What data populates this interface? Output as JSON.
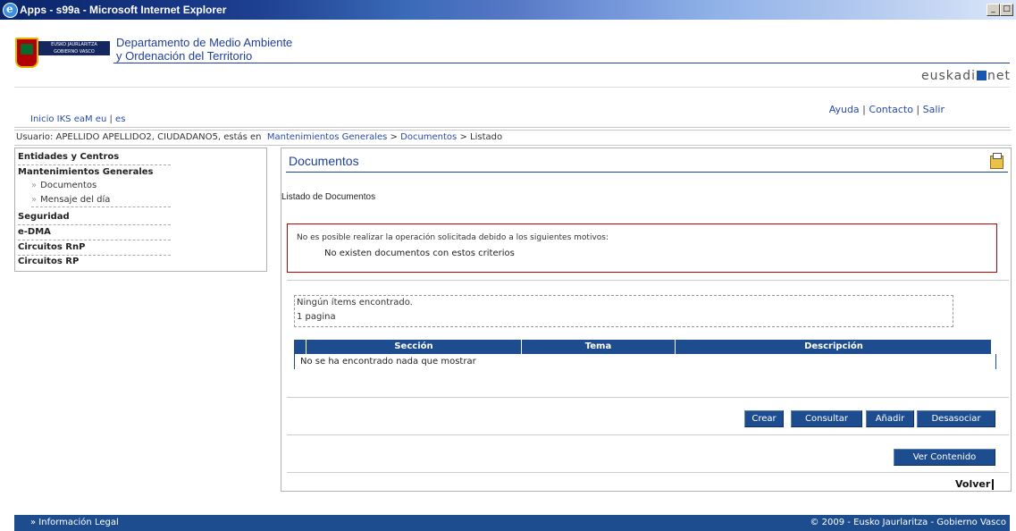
{
  "window": {
    "title": "Apps - s99a - Microsoft Internet Explorer"
  },
  "header": {
    "logo_text": "EUSKO JAURLARITZA GOBIERNO VASCO",
    "dept_line1": "Departamento de Medio Ambiente",
    "dept_line2": "y Ordenación del Territorio",
    "portal_pre": "euskadi",
    "portal_post": "net"
  },
  "topnav": {
    "links": [
      "Inicio",
      "IKS eaM",
      "eu",
      "es"
    ],
    "util": [
      "Ayuda",
      "Contacto",
      "Salir"
    ]
  },
  "userbar": {
    "prefix": "Usuario: APELLIDO APELLIDO2, CIUDADANO5, estás en",
    "crumbs": [
      "Mantenimientos Generales",
      "Documentos",
      "Listado"
    ],
    "sep": ">"
  },
  "sidebar": {
    "items": [
      {
        "label": "Entidades y Centros"
      },
      {
        "label": "Mantenimientos Generales",
        "subs": [
          "Documentos",
          "Mensaje del día"
        ]
      },
      {
        "label": "Seguridad"
      },
      {
        "label": "e-DMA"
      },
      {
        "label": "Circuitos RnP"
      },
      {
        "label": "Circuitos RP"
      }
    ]
  },
  "main": {
    "title": "Documentos",
    "subtitle": "Listado de Documentos",
    "error_line1": "No es posible realizar la operación solicitada debido a los siguientes motivos:",
    "error_line2": "No existen documentos con estos criterios",
    "info_line1": "Ningún ítems encontrado.",
    "info_line2": "1 pagina",
    "columns": [
      "Sección",
      "Tema",
      "Descripción"
    ],
    "empty_text": "No se ha encontrado nada que mostrar",
    "buttons": {
      "crear": "Crear",
      "consultar": "Consultar",
      "anadir": "Añadir",
      "desasociar": "Desasociar",
      "ver": "Ver Contenido"
    },
    "volver": "Volver"
  },
  "footer": {
    "left": "» Información Legal",
    "right": "© 2009 - Eusko Jaurlaritza - Gobierno Vasco"
  }
}
